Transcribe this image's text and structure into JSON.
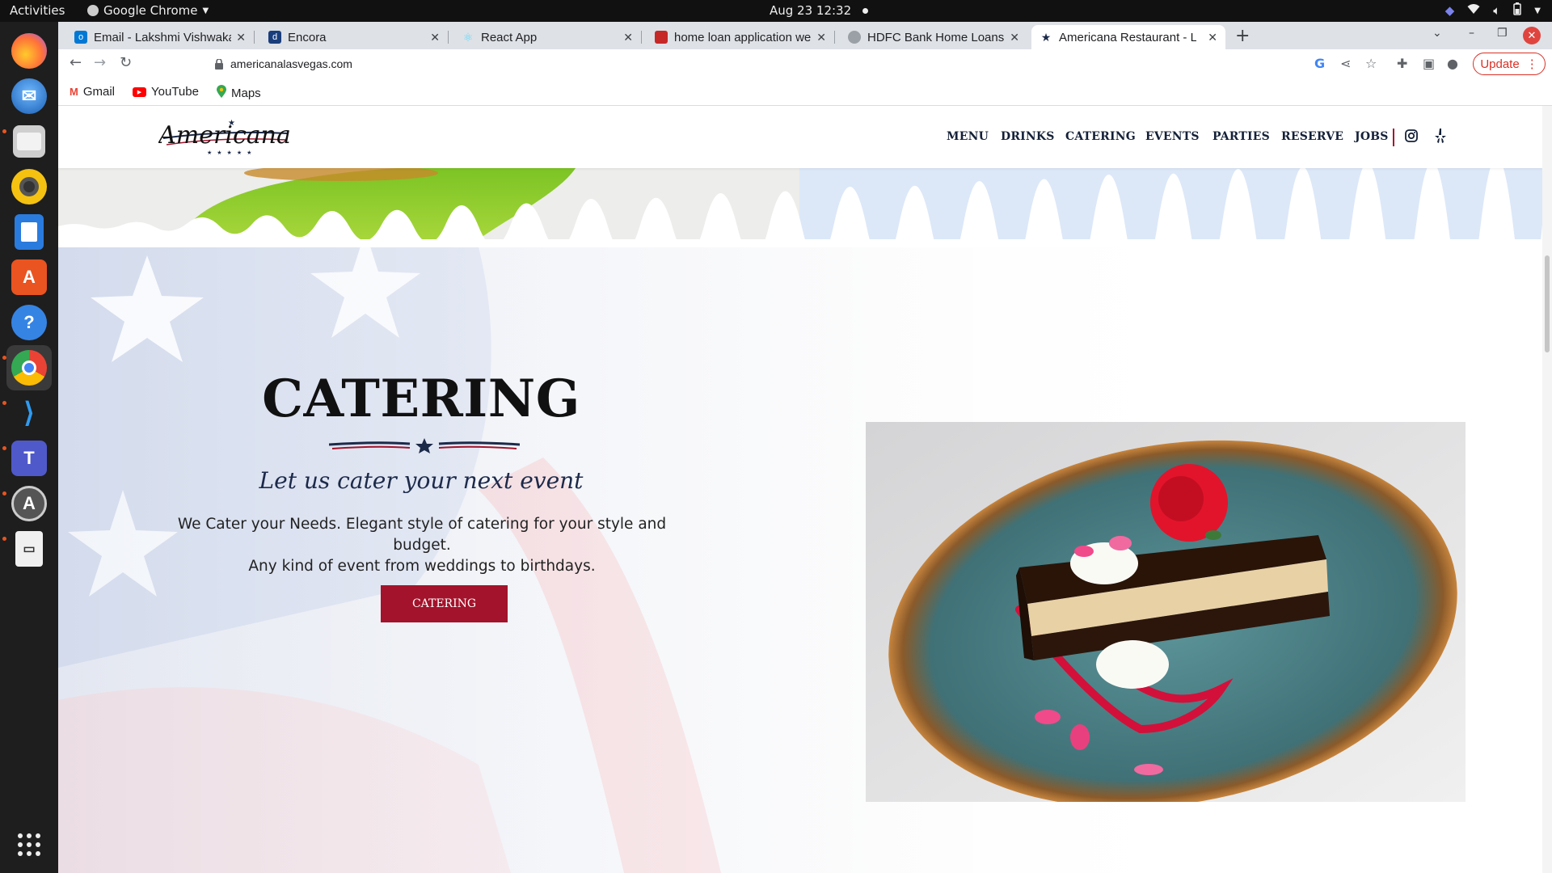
{
  "system": {
    "activities": "Activities",
    "app_name": "Google Chrome",
    "clock": "Aug 23  12:32"
  },
  "dock": {
    "items": [
      "firefox-icon",
      "thunderbird-icon",
      "files-icon",
      "rhythmbox-icon",
      "libreoffice-writer-icon",
      "app-center-icon",
      "help-icon",
      "chrome-icon",
      "vscode-icon",
      "teams-icon",
      "software-updater-icon",
      "document-viewer-icon",
      "app-grid-icon"
    ]
  },
  "browser": {
    "tabs": [
      {
        "title": "Email - Lakshmi Vishwaka",
        "favicon": "outlook-icon",
        "color": "#0078d4"
      },
      {
        "title": "Encora",
        "favicon": "encora-icon",
        "color": "#1a3d7c"
      },
      {
        "title": "React App",
        "favicon": "react-icon",
        "color": "#61dafb"
      },
      {
        "title": "home loan application we",
        "favicon": "page-icon",
        "color": "#c62828"
      },
      {
        "title": "HDFC Bank Home Loans |",
        "favicon": "globe-icon",
        "color": "#9aa0a6"
      },
      {
        "title": "Americana Restaurant - La",
        "favicon": "star-icon",
        "color": "#1c2a4a"
      }
    ],
    "url": "americanalasvegas.com",
    "update_label": "Update",
    "bookmarks": [
      {
        "label": "Gmail",
        "icon": "gmail-icon"
      },
      {
        "label": "YouTube",
        "icon": "youtube-icon"
      },
      {
        "label": "Maps",
        "icon": "maps-icon"
      }
    ]
  },
  "site": {
    "logo_text": "Americana",
    "nav": [
      "MENU",
      "DRINKS",
      "CATERING",
      "EVENTS",
      "PARTIES",
      "RESERVE",
      "JOBS"
    ],
    "catering": {
      "title": "CATERING",
      "subtitle": "Let us cater your next event",
      "desc_line1": "We Cater your Needs. Elegant style of catering for your style and budget.",
      "desc_line2": "Any kind of event from weddings to birthdays.",
      "button": "CATERING"
    }
  },
  "colors": {
    "brand_red": "#a3132b",
    "brand_navy": "#142038",
    "hero_blue": "#dce8f8",
    "plate_teal": "#4b7f84"
  }
}
